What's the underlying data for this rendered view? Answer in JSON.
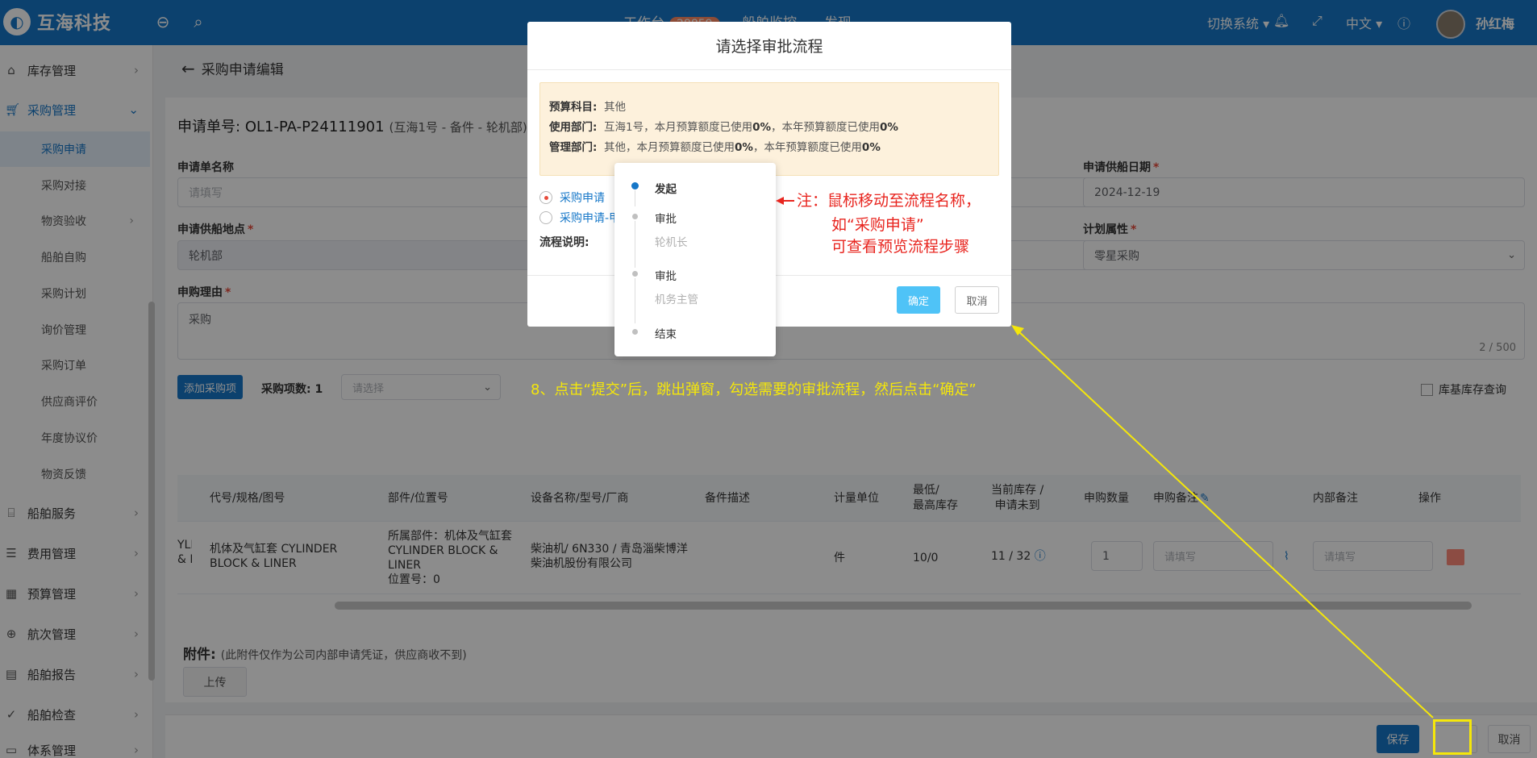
{
  "app": {
    "name": "互海科技"
  },
  "topbar": {
    "nav": [
      {
        "label": "工作台",
        "badge": "28859"
      },
      {
        "label": "船舶监控"
      },
      {
        "label": "发现"
      }
    ],
    "switch_system": "切换系统",
    "language": "中文",
    "user_name": "孙红梅"
  },
  "sidebar": {
    "items": [
      {
        "label": "库存管理",
        "icon": "home-icon"
      },
      {
        "label": "采购管理",
        "icon": "cart-icon"
      },
      {
        "label": "船舶服务",
        "icon": "brush-icon"
      },
      {
        "label": "费用管理",
        "icon": "coins-icon"
      },
      {
        "label": "预算管理",
        "icon": "table-icon"
      },
      {
        "label": "航次管理",
        "icon": "globe-icon"
      },
      {
        "label": "船舶报告",
        "icon": "calendar-icon"
      },
      {
        "label": "船舶检查",
        "icon": "check-circle-icon"
      },
      {
        "label": "体系管理",
        "icon": "doc-icon"
      }
    ],
    "subitems": [
      "采购申请",
      "采购对接",
      "物资验收",
      "船舶自购",
      "采购计划",
      "询价管理",
      "采购订单",
      "供应商评价",
      "年度协议价",
      "物资反馈"
    ]
  },
  "page": {
    "breadcrumb": "采购申请编辑",
    "request_no_label": "申请单号:",
    "request_no": "OL1-PA-P24111901",
    "request_no_sub": "(互海1号 - 备件 - 轮机部)",
    "fields": {
      "name_label": "申请单名称",
      "name_placeholder": "请填写",
      "date_label": "申请供船日期",
      "date_value": "2024-12-19",
      "location_label": "申请供船地点",
      "location_value": "轮机部",
      "plan_label": "计划属性",
      "plan_value": "零星采购",
      "reason_label": "申购理由",
      "reason_value": "采购",
      "reason_count": "2 / 500"
    },
    "add_item_button": "添加采购项",
    "item_count_label": "采购项数:",
    "item_count": "1",
    "select_placeholder": "请选择",
    "stock_query_label": "库基库存查询",
    "table": {
      "headers": [
        "代号/规格/图号",
        "部件/位置号",
        "设备名称/型号/厂商",
        "备件描述",
        "计量单位",
        "最低/\n最高库存",
        "当前库存 /\n申请未到",
        "申购数量",
        "申购备注",
        "内部备注",
        "操作"
      ],
      "row": {
        "clip": "YLI\n& L",
        "code": "机体及气缸套 CYLINDER BLOCK & LINER",
        "part": "所属部件：机体及气缸套 CYLINDER BLOCK & LINER",
        "position": "位置号：0",
        "device": "柴油机/ 6N330 / 青岛淄柴博洋柴油机股份有限公司",
        "unit": "件",
        "minmax": "10/0",
        "stock": "11 / 32",
        "qty": "1",
        "remark_placeholder": "请填写",
        "internal_placeholder": "请填写"
      }
    },
    "attachment_label": "附件:",
    "attachment_note": "(此附件仅作为公司内部申请凭证，供应商收不到)",
    "upload_button": "上传",
    "save_button": "保存",
    "cancel_button": "取消"
  },
  "dialog": {
    "title": "请选择审批流程",
    "budget_subject_label": "预算科目:",
    "budget_subject": "其他",
    "use_dept_label": "使用部门:",
    "use_dept_prefix": "互海1号，本月预算额度已使用",
    "use_dept_month": "0%",
    "use_dept_mid": "，本年预算额度已使用",
    "use_dept_year": "0%",
    "mgmt_dept_label": "管理部门:",
    "mgmt_dept_prefix": "其他，本月预算额度已使用",
    "mgmt_dept_month": "0%",
    "mgmt_dept_mid": "，本年预算额度已使用",
    "mgmt_dept_year": "0%",
    "flows": [
      "采购申请",
      "采购申请-甲"
    ],
    "desc_label": "流程说明:",
    "ok_button": "确定",
    "cancel_button": "取消"
  },
  "popover_steps": [
    {
      "title": "发起"
    },
    {
      "title": "审批",
      "sub": "轮机长"
    },
    {
      "title": "审批",
      "sub": "机务主管"
    },
    {
      "title": "结束"
    }
  ],
  "annotations": {
    "note_line1": "注：鼠标移动至流程名称，",
    "note_line2": "如“采购申请”",
    "note_line3": "可查看预览流程步骤",
    "step8": "8、点击“提交”后，跳出弹窗，勾选需要的审批流程，然后点击“确定”",
    "colors": {
      "note": "#e8251f",
      "step": "#f5e70a"
    }
  }
}
